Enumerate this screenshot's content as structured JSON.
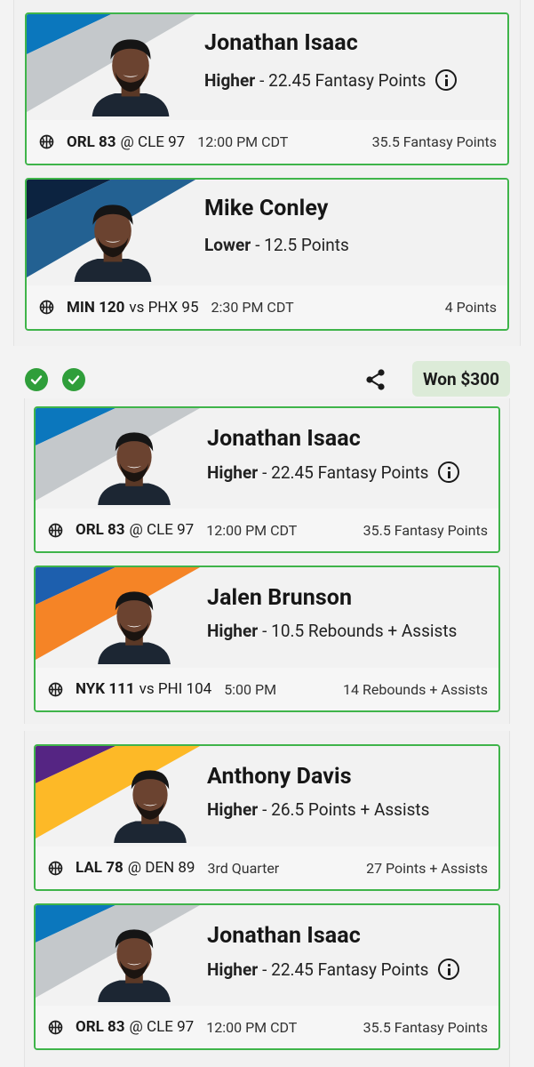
{
  "colors": {
    "card_border": "#3fb44a",
    "check_green": "#2f9e3a",
    "won_badge_bg": "#dcebd8",
    "orl_blue": "#0b77bd",
    "min_navy": "#0c2340",
    "nyk_orange": "#f58426",
    "lal_purple": "#552583",
    "lal_gold": "#fdb927"
  },
  "entry_one": {
    "picks": [
      {
        "player": "Jonathan Isaac",
        "direction": "Higher",
        "line": "22.45 Fantasy Points",
        "has_info_icon": true,
        "team_score": "ORL 83",
        "opponent": "@ CLE 97",
        "status": "12:00 PM CDT",
        "result": "35.5 Fantasy Points",
        "icon": "basketball-icon"
      },
      {
        "player": "Mike Conley",
        "direction": "Lower",
        "line": "12.5 Points",
        "has_info_icon": false,
        "team_score": "MIN 120",
        "opponent": "vs PHX 95",
        "status": "2:30 PM CDT",
        "result": "4 Points",
        "icon": "basketball-icon"
      }
    ]
  },
  "entry_two": {
    "status_icons": [
      "check-circle-icon",
      "check-circle-icon"
    ],
    "share_icon": "share-icon",
    "won_label": "Won $300",
    "picks": [
      {
        "player": "Jonathan Isaac",
        "direction": "Higher",
        "line": "22.45 Fantasy Points",
        "has_info_icon": true,
        "team_score": "ORL 83",
        "opponent": "@ CLE 97",
        "status": "12:00 PM CDT",
        "result": "35.5 Fantasy Points",
        "icon": "basketball-icon"
      },
      {
        "player": "Jalen Brunson",
        "direction": "Higher",
        "line": "10.5 Rebounds + Assists",
        "has_info_icon": false,
        "team_score": "NYK 111",
        "opponent": "vs PHI 104",
        "status": "5:00 PM",
        "result": "14 Rebounds + Assists",
        "icon": "basketball-icon"
      }
    ]
  },
  "entry_three": {
    "picks": [
      {
        "player": "Anthony Davis",
        "direction": "Higher",
        "line": "26.5 Points + Assists",
        "has_info_icon": false,
        "team_score": "LAL 78",
        "opponent": "@ DEN 89",
        "status": "3rd Quarter",
        "result": "27 Points + Assists",
        "icon": "basketball-icon"
      },
      {
        "player": "Jonathan Isaac",
        "direction": "Higher",
        "line": "22.45 Fantasy Points",
        "has_info_icon": true,
        "team_score": "ORL 83",
        "opponent": "@ CLE 97",
        "status": "12:00 PM CDT",
        "result": "35.5 Fantasy Points",
        "icon": "basketball-icon"
      }
    ]
  }
}
